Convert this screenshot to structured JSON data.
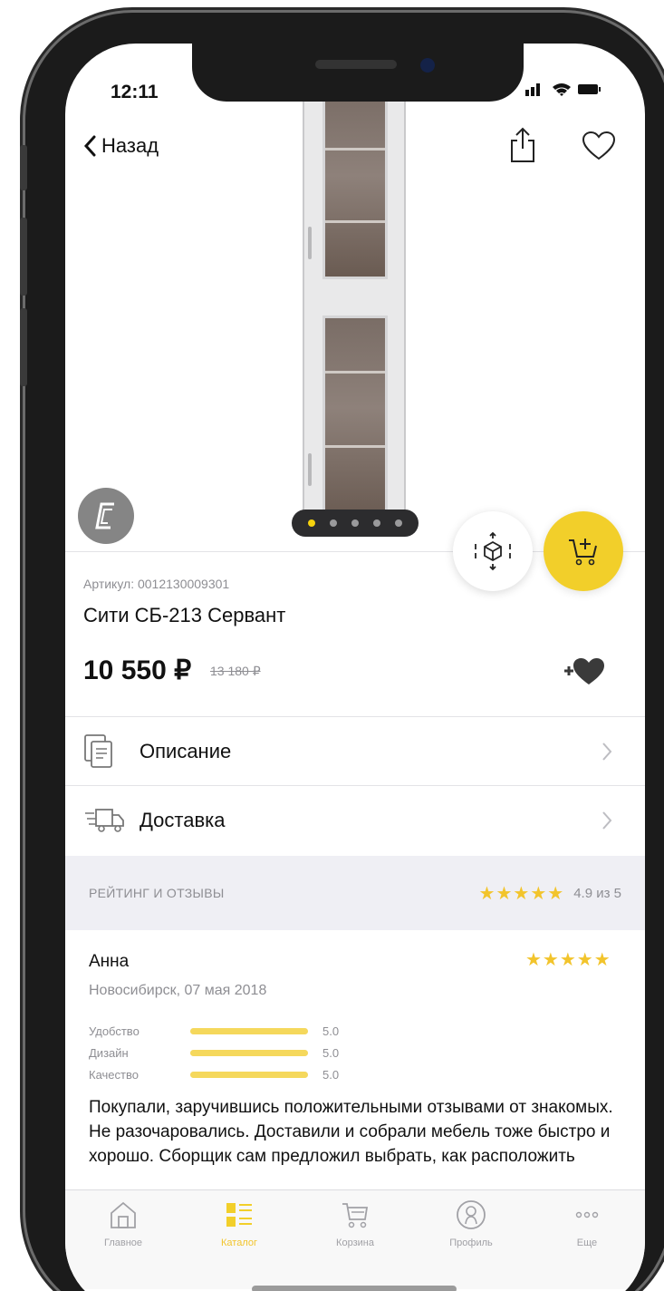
{
  "status_bar": {
    "time": "12:11",
    "icons": "📶 ᯤ ▬"
  },
  "nav": {
    "back_label": "Назад"
  },
  "gallery": {
    "pages": 5,
    "current_page": 1,
    "brand_initial": "С"
  },
  "product": {
    "sku": "Артикул: 0012130009301",
    "name": "Сити СБ-213 Сервант",
    "price": "10 550 ₽",
    "old_price": "13 180 ₽"
  },
  "menu": [
    {
      "label": "Описание",
      "icon": "document-icon"
    },
    {
      "label": "Доставка",
      "icon": "delivery-truck-icon"
    }
  ],
  "rating": {
    "label": "РЕЙТИНГ И ОТЗЫВЫ",
    "stars": "★★★★★",
    "score": "4.9 из 5"
  },
  "review": {
    "author": "Анна",
    "stars": "★★★★★",
    "meta": "Новосибирск, 07 мая 2018",
    "criteria": [
      {
        "name": "Удобство",
        "value": "5.0",
        "fraction": 1.0
      },
      {
        "name": "Дизайн",
        "value": "5.0",
        "fraction": 1.0
      },
      {
        "name": "Качество",
        "value": "5.0",
        "fraction": 1.0
      }
    ],
    "text": "Покупали, заручившись положительными отзывами от знакомых. Не разочаровались. Доставили и собрали мебель тоже быстро и хорошо. Сборщик сам предложил выбрать, как расположить"
  },
  "tabbar": [
    {
      "label": "Главное",
      "icon": "home-icon",
      "active": false
    },
    {
      "label": "Каталог",
      "icon": "catalog-icon",
      "active": true
    },
    {
      "label": "Корзина",
      "icon": "cart-icon",
      "active": false
    },
    {
      "label": "Профиль",
      "icon": "profile-icon",
      "active": false
    },
    {
      "label": "Еще",
      "icon": "more-icon",
      "active": false
    }
  ],
  "colors": {
    "accent": "#f2cf2a",
    "muted": "#8e8e93",
    "band": "#efeff4"
  }
}
